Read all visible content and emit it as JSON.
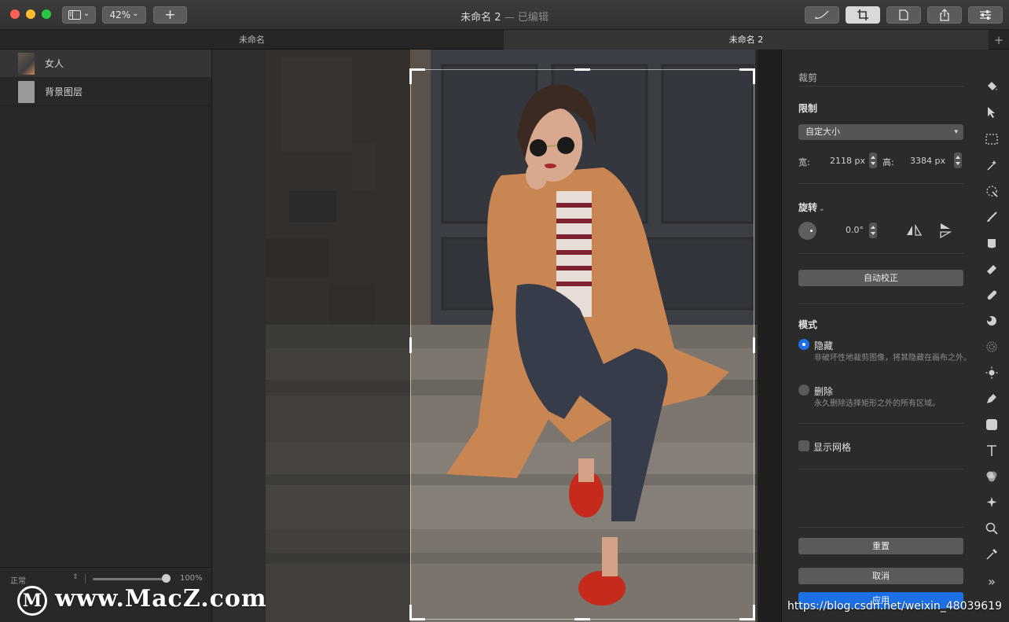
{
  "window": {
    "title": "未命名 2",
    "title_status": "— 已编辑",
    "zoom": "42%",
    "zoom_chevron": "⌄",
    "sidebar_chevron": "⌄",
    "new_button": "+"
  },
  "tabs": [
    {
      "label": "未命名",
      "active": false
    },
    {
      "label": "未命名 2",
      "active": true
    }
  ],
  "tab_add": "+",
  "layers": {
    "items": [
      {
        "name": "女人",
        "selected": true
      },
      {
        "name": "背景图层",
        "selected": false
      }
    ],
    "blend_mode": "正常",
    "opacity": "100%",
    "opacity_fraction": 1.0
  },
  "inspector": {
    "panel_title": "裁剪",
    "constrain": {
      "label": "限制",
      "selected": "自定大小"
    },
    "size": {
      "width_label": "宽:",
      "width_value": "2118 px",
      "height_label": "高:",
      "height_value": "3384 px"
    },
    "rotate": {
      "label": "旋转",
      "chevron": "⌄",
      "angle": "0.0°"
    },
    "auto_straighten": "自动校正",
    "mode": {
      "label": "模式",
      "options": [
        {
          "label": "隐藏",
          "hint": "非破坏性地裁剪图像，将其隐藏在画布之外。",
          "checked": true
        },
        {
          "label": "删除",
          "hint": "永久删除选择矩形之外的所有区域。",
          "checked": false
        }
      ]
    },
    "show_grid": {
      "label": "显示网格",
      "checked": false
    },
    "reset": "重置",
    "cancel": "取消",
    "apply": "应用"
  },
  "tools_more": "»",
  "watermark": {
    "logo_letter": "M",
    "site": "www.MacZ.com",
    "url": "https://blog.csdn.net/weixin_48039619"
  },
  "colors": {
    "accent": "#1d6fe6",
    "coat": "#c98653",
    "shoes": "#c52a1c",
    "door": "#3b3e44"
  }
}
